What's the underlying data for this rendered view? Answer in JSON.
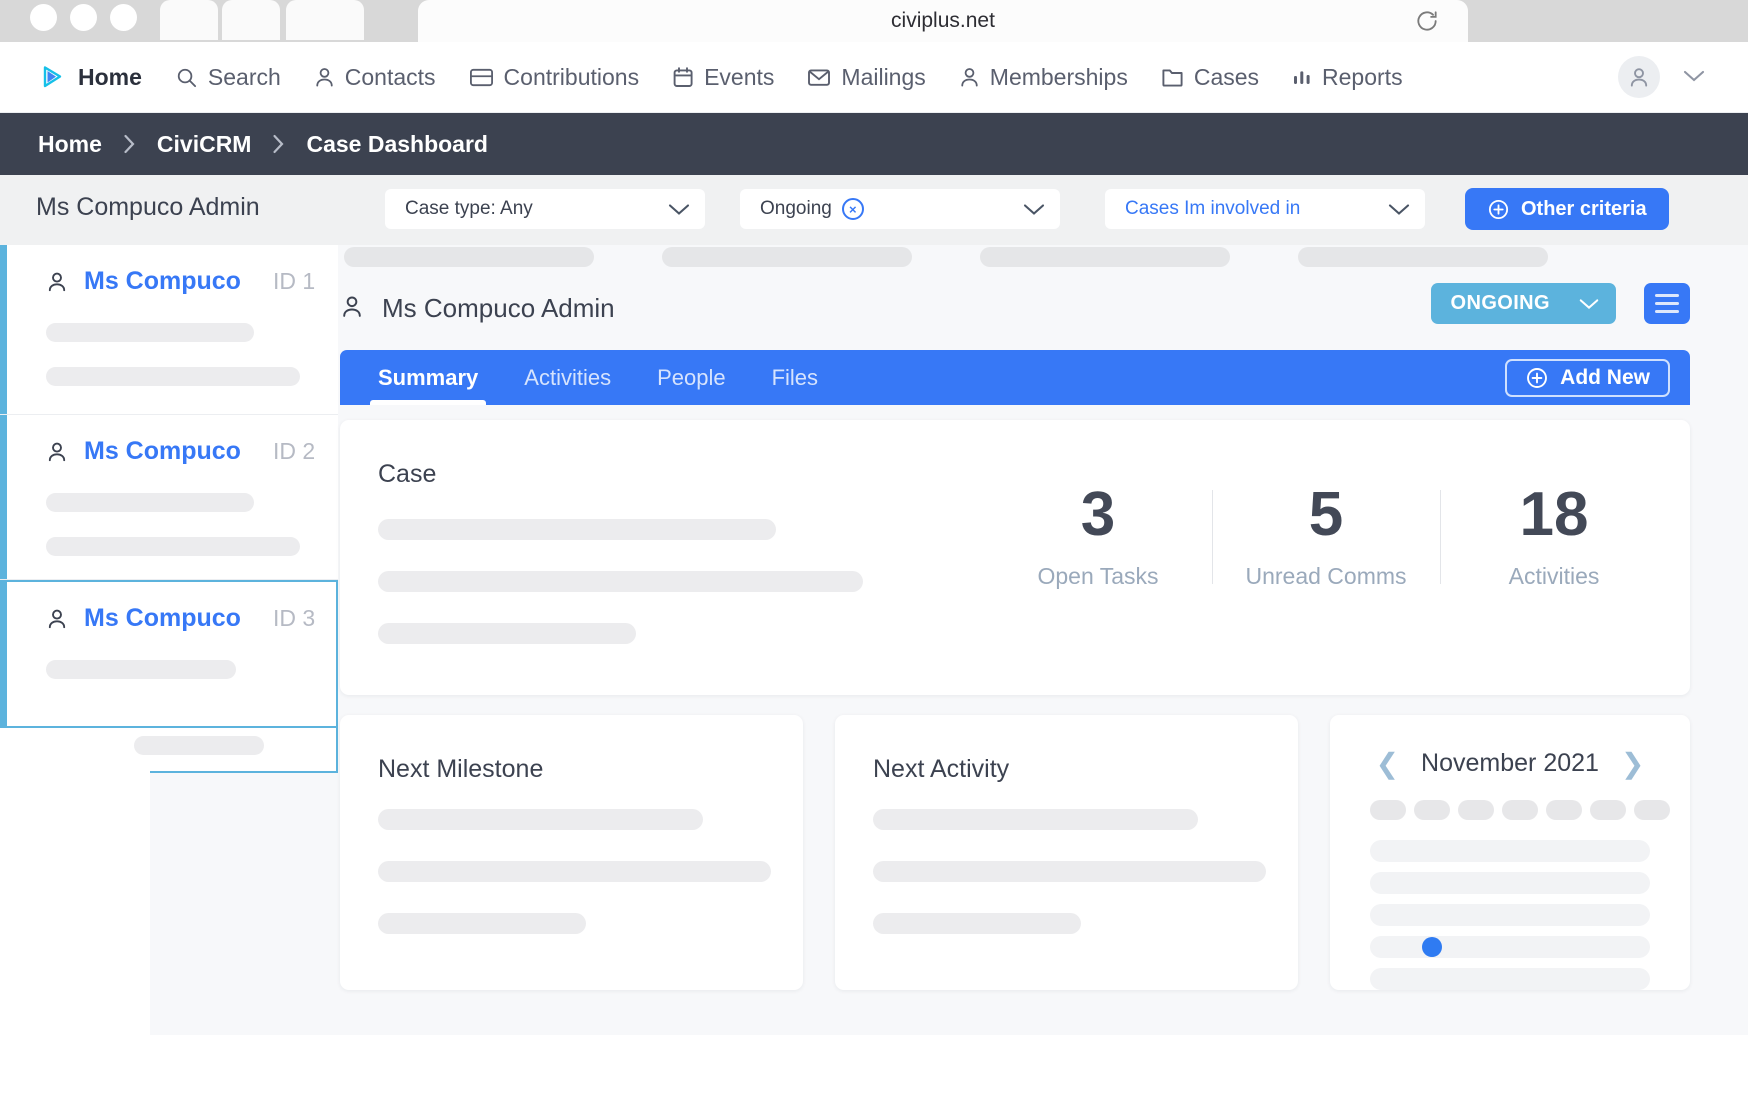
{
  "browser": {
    "url": "civiplus.net",
    "reload_icon": "reload-icon",
    "tabs": [
      "",
      "",
      ""
    ]
  },
  "nav": {
    "logo_icon": "civicrm-logo-icon",
    "items": [
      {
        "label": "Home",
        "icon": "play-triangle-icon"
      },
      {
        "label": "Search",
        "icon": "search-icon"
      },
      {
        "label": "Contacts",
        "icon": "person-icon"
      },
      {
        "label": "Contributions",
        "icon": "card-icon"
      },
      {
        "label": "Events",
        "icon": "calendar-icon"
      },
      {
        "label": "Mailings",
        "icon": "envelope-icon"
      },
      {
        "label": "Memberships",
        "icon": "person-icon"
      },
      {
        "label": "Cases",
        "icon": "folder-icon"
      },
      {
        "label": "Reports",
        "icon": "bar-chart-icon"
      }
    ],
    "avatar_icon": "user-avatar-icon",
    "caret_icon": "chevron-down-icon"
  },
  "breadcrumb": {
    "items": [
      "Home",
      "CiviCRM",
      "Case Dashboard"
    ],
    "separator": ">"
  },
  "filters": {
    "title": "Ms Compuco Admin",
    "case_type": {
      "label": "Case type: Any",
      "caret": "chevron-down-icon"
    },
    "status": {
      "label": "Ongoing",
      "chip_remove": "×",
      "caret": "chevron-down-icon"
    },
    "involvement": {
      "label": "Cases Im involved in",
      "caret": "chevron-down-icon"
    },
    "other_criteria": {
      "label": "Other criteria",
      "icon": "plus-circle-icon"
    }
  },
  "case_list": [
    {
      "name": "Ms Compuco",
      "id_label": "ID 1",
      "icon": "person-icon",
      "selected": false
    },
    {
      "name": "Ms Compuco",
      "id_label": "ID 2",
      "icon": "person-icon",
      "selected": false
    },
    {
      "name": "Ms Compuco",
      "id_label": "ID 3",
      "icon": "person-icon",
      "selected": true
    }
  ],
  "panel": {
    "contact_name": "Ms Compuco Admin",
    "contact_icon": "person-icon",
    "status_badge": {
      "label": "ONGOING",
      "caret": "chevron-down-icon",
      "color": "#5cb3dd"
    },
    "menu_icon": "hamburger-menu-icon",
    "tabs": [
      {
        "label": "Summary",
        "active": true
      },
      {
        "label": "Activities",
        "active": false
      },
      {
        "label": "People",
        "active": false
      },
      {
        "label": "Files",
        "active": false
      }
    ],
    "add_new": {
      "label": "Add New",
      "icon": "plus-circle-icon"
    },
    "accent_color": "#3778f6"
  },
  "case_card": {
    "title": "Case",
    "stats": [
      {
        "value": "3",
        "label": "Open Tasks"
      },
      {
        "value": "5",
        "label": "Unread Comms"
      },
      {
        "value": "18",
        "label": "Activities"
      }
    ]
  },
  "mini_cards": [
    {
      "title": "Next Milestone"
    },
    {
      "title": "Next Activity"
    }
  ],
  "calendar": {
    "month_label": "November 2021",
    "prev_icon": "chevron-left-icon",
    "next_icon": "chevron-right-icon",
    "day_count": 7,
    "week_rows": 5,
    "marked_day_row": 4,
    "marked_color": "#2f7bf2"
  }
}
